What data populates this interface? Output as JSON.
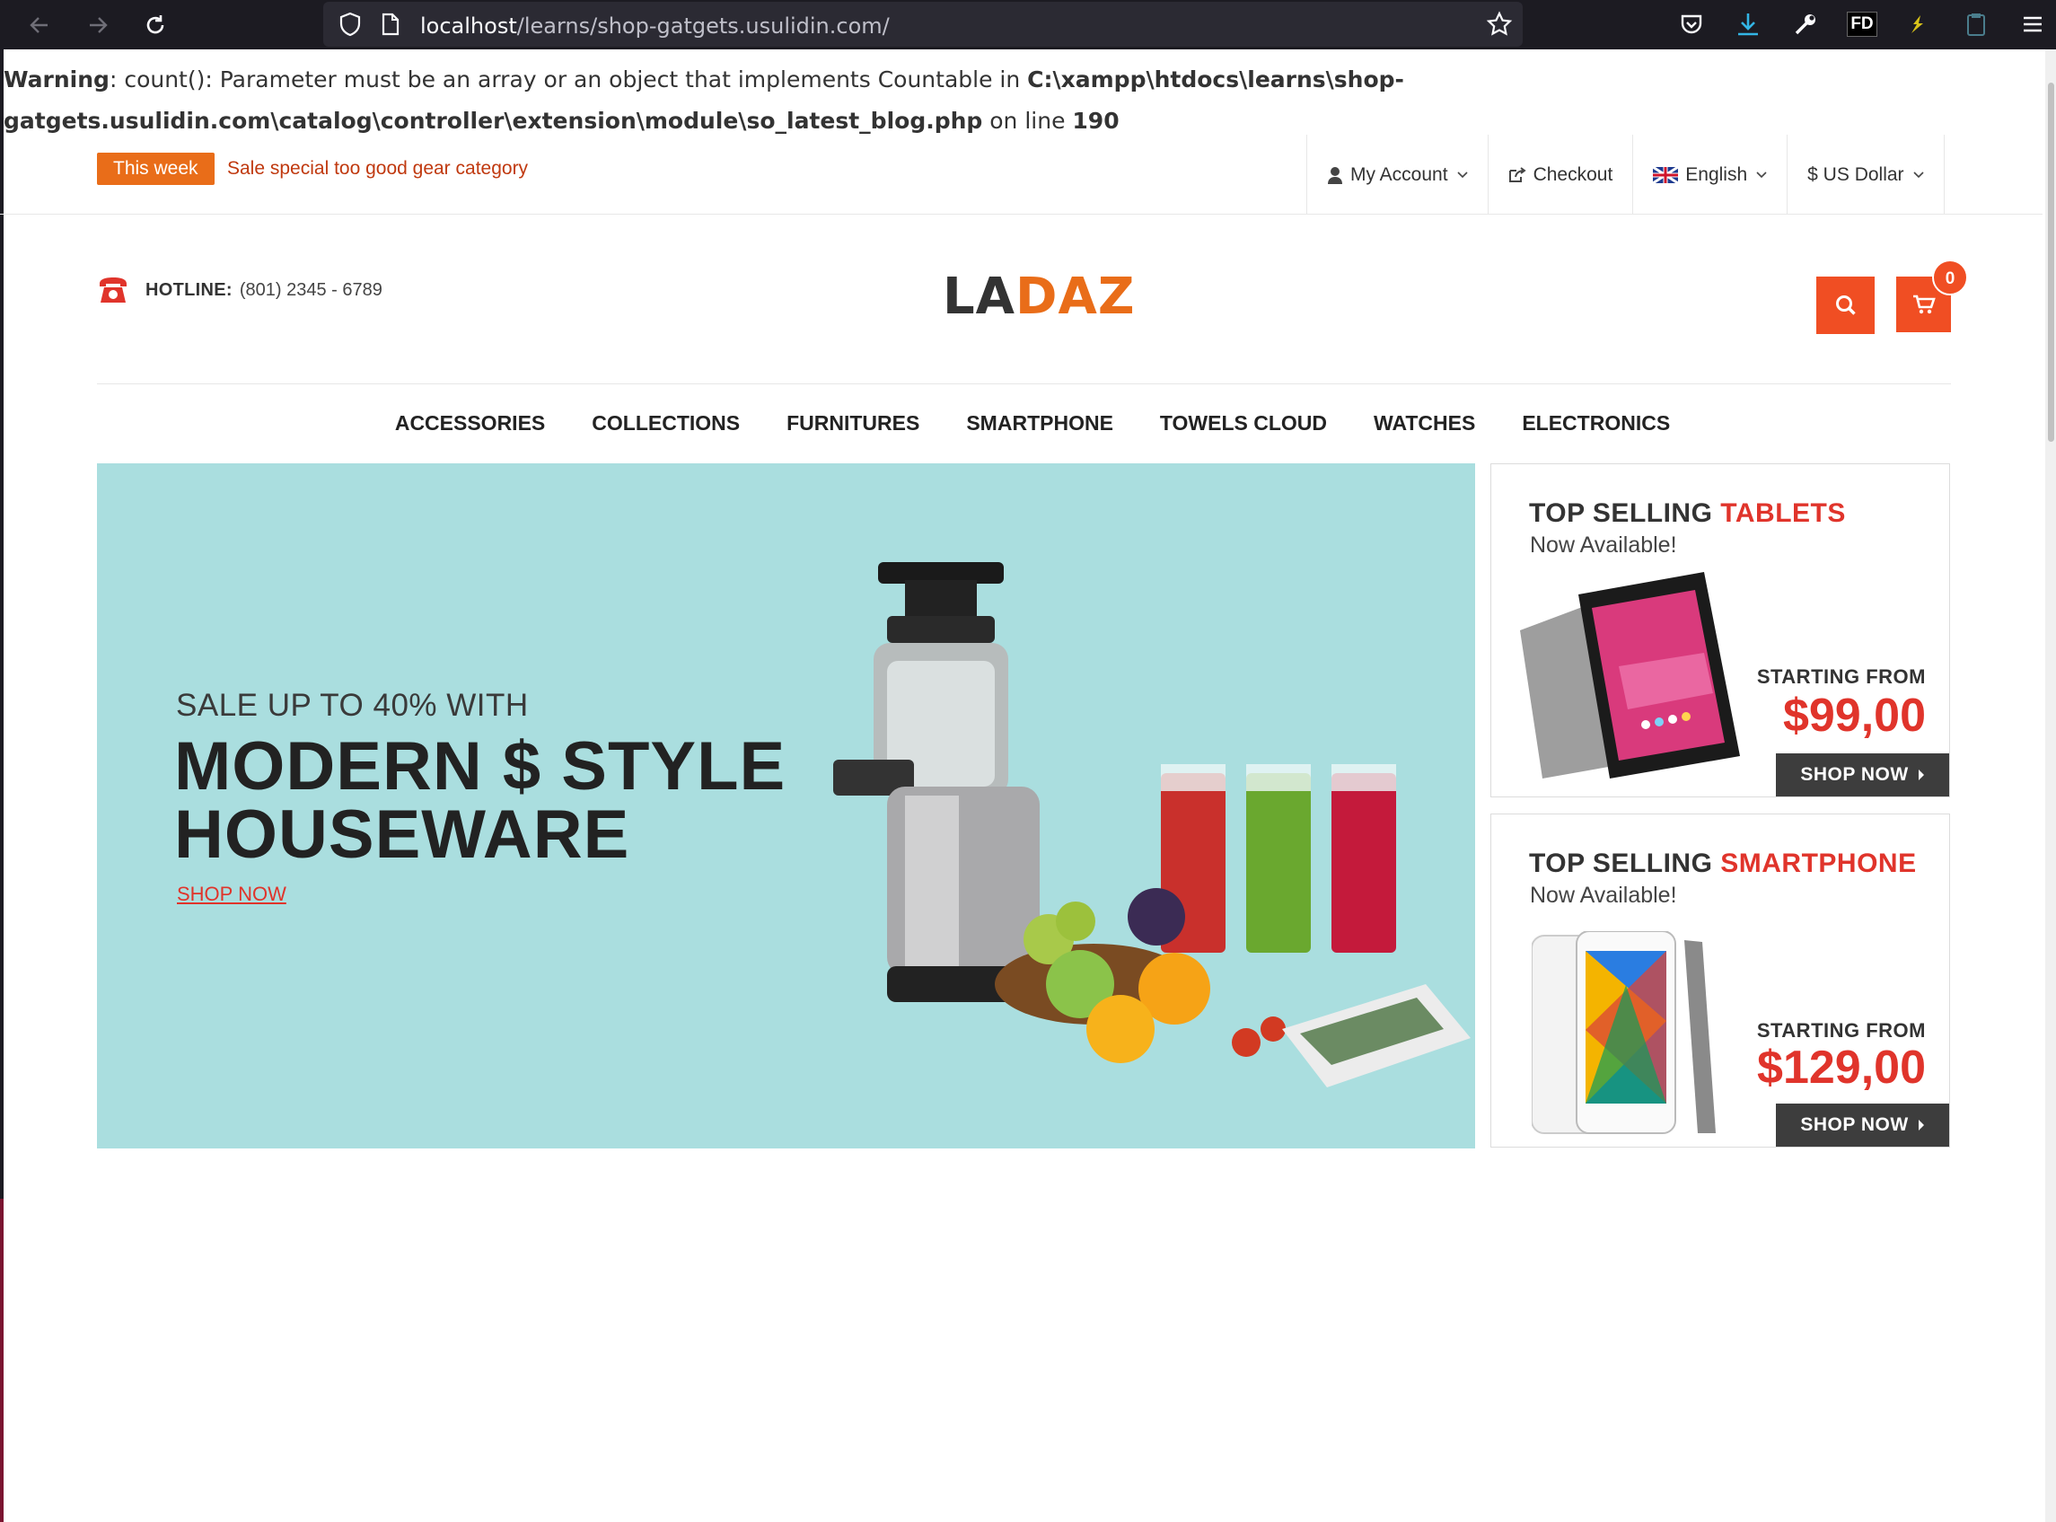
{
  "browser": {
    "url_host": "localhost",
    "url_path": "/learns/shop-gatgets.usulidin.com/",
    "extension_label": "FD"
  },
  "warning": {
    "label": "Warning",
    "message": ": count(): Parameter must be an array or an object that implements Countable in ",
    "file": "C:\\xampp\\htdocs\\learns\\shop-gatgets.usulidin.com\\catalog\\controller\\extension\\module\\so_latest_blog.php",
    "on": " on line ",
    "line": "190"
  },
  "topbar": {
    "badge": "This week",
    "promo": "Sale special too good gear category",
    "account": "My Account",
    "checkout": "Checkout",
    "language": "English",
    "currency": "$ US Dollar"
  },
  "header": {
    "hotline_label": "HOTLINE:",
    "hotline_number": "(801) 2345 - 6789",
    "logo_part1": "LA",
    "logo_part2": "DAZ",
    "cart_count": "0",
    "accent_color": "#f04e23"
  },
  "nav": {
    "items": [
      "ACCESSORIES",
      "COLLECTIONS",
      "FURNITURES",
      "SMARTPHONE",
      "TOWELS CLOUD",
      "WATCHES",
      "ELECTRONICS"
    ]
  },
  "hero": {
    "subtitle": "SALE UP TO 40% WITH",
    "title_line1": "MODERN $ STYLE",
    "title_line2": "HOUSEWARE",
    "link": "SHOP NOW",
    "background": "#aadedf"
  },
  "banners": [
    {
      "title": "TOP SELLING ",
      "title_accent": "TABLETS",
      "subtitle": "Now Available!",
      "from": "STARTING FROM",
      "price": "$99,00",
      "button": "SHOP NOW"
    },
    {
      "title": "TOP SELLING ",
      "title_accent": "SMARTPHONE",
      "subtitle": "Now Available!",
      "from": "STARTING FROM",
      "price": "$129,00",
      "button": "SHOP NOW"
    }
  ]
}
